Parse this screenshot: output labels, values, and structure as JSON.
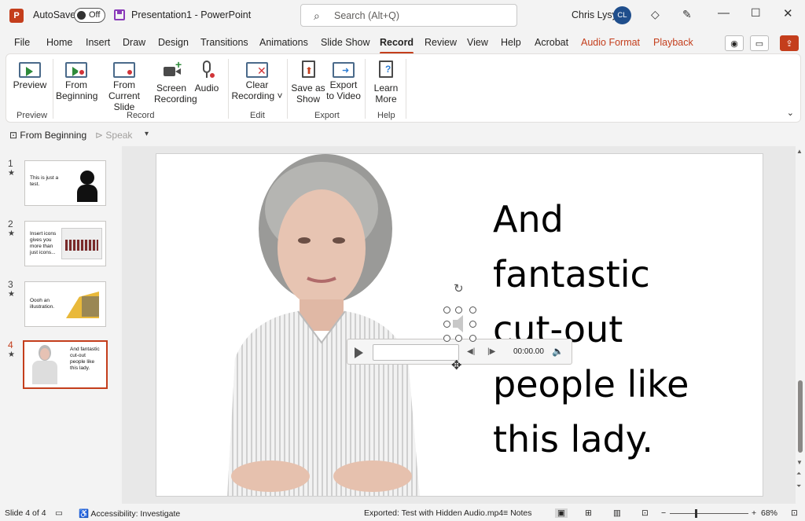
{
  "titlebar": {
    "logo": "P",
    "autosave_label": "AutoSave",
    "autosave_state": "Off",
    "doc_title": "Presentation1  -  PowerPoint",
    "search_placeholder": "Search (Alt+Q)",
    "user_name": "Chris Lysy",
    "user_initials": "CL"
  },
  "tabs": [
    "File",
    "Home",
    "Insert",
    "Draw",
    "Design",
    "Transitions",
    "Animations",
    "Slide Show",
    "Record",
    "Review",
    "View",
    "Help",
    "Acrobat",
    "Audio Format",
    "Playback"
  ],
  "active_tab": "Record",
  "ribbon": {
    "preview": {
      "label": "Preview",
      "group": "Preview"
    },
    "from_beginning": {
      "line1": "From",
      "line2": "Beginning"
    },
    "from_current": {
      "line1": "From",
      "line2": "Current Slide"
    },
    "screen_recording": {
      "line1": "Screen",
      "line2": "Recording"
    },
    "audio": {
      "label": "Audio"
    },
    "record_group": "Record",
    "clear_recording": {
      "line1": "Clear",
      "line2": "Recording ˅"
    },
    "edit_group": "Edit",
    "save_as_show": {
      "line1": "Save as",
      "line2": "Show"
    },
    "export_to_video": {
      "line1": "Export",
      "line2": "to Video"
    },
    "export_group": "Export",
    "learn_more": {
      "line1": "Learn",
      "line2": "More"
    },
    "help_group": "Help"
  },
  "qat": {
    "from_beginning": "From Beginning",
    "speak": "Speak"
  },
  "slides": [
    {
      "num": "1",
      "text": "This is just a test."
    },
    {
      "num": "2",
      "text": "Insert icons gives you more than just icons..."
    },
    {
      "num": "3",
      "text": "Oooh an illustration."
    },
    {
      "num": "4",
      "text": "And fantastic cut-out people like this lady."
    }
  ],
  "main_slide": {
    "text_lines": [
      "And",
      "fantastic",
      "cut-out",
      "people like",
      "this lady."
    ]
  },
  "audio_player": {
    "time": "00:00.00"
  },
  "statusbar": {
    "slide_counter": "Slide 4 of 4",
    "accessibility": "Accessibility: Investigate",
    "exported": "Exported: Test with Hidden Audio.mp4",
    "notes": "Notes",
    "zoom": "68%"
  },
  "colors": {
    "accent": "#c43e1c",
    "ribbon_bg": "#ffffff",
    "chrome_bg": "#f3f3f3"
  }
}
